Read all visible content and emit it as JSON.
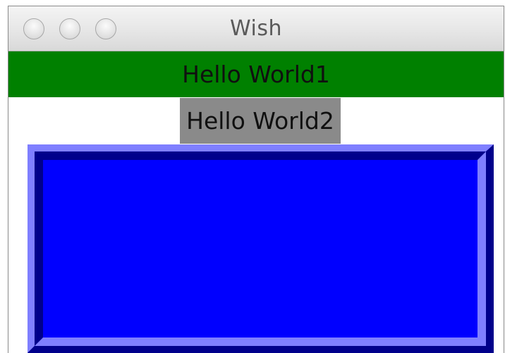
{
  "window": {
    "title": "Wish"
  },
  "labels": {
    "first": "Hello World1",
    "second": "Hello World2"
  },
  "colors": {
    "label1_bg": "#008000",
    "label2_bg": "#8a8a8a",
    "frame_fill": "#0000ff",
    "frame_light": "#7f7fff",
    "frame_dark": "#00008b"
  }
}
